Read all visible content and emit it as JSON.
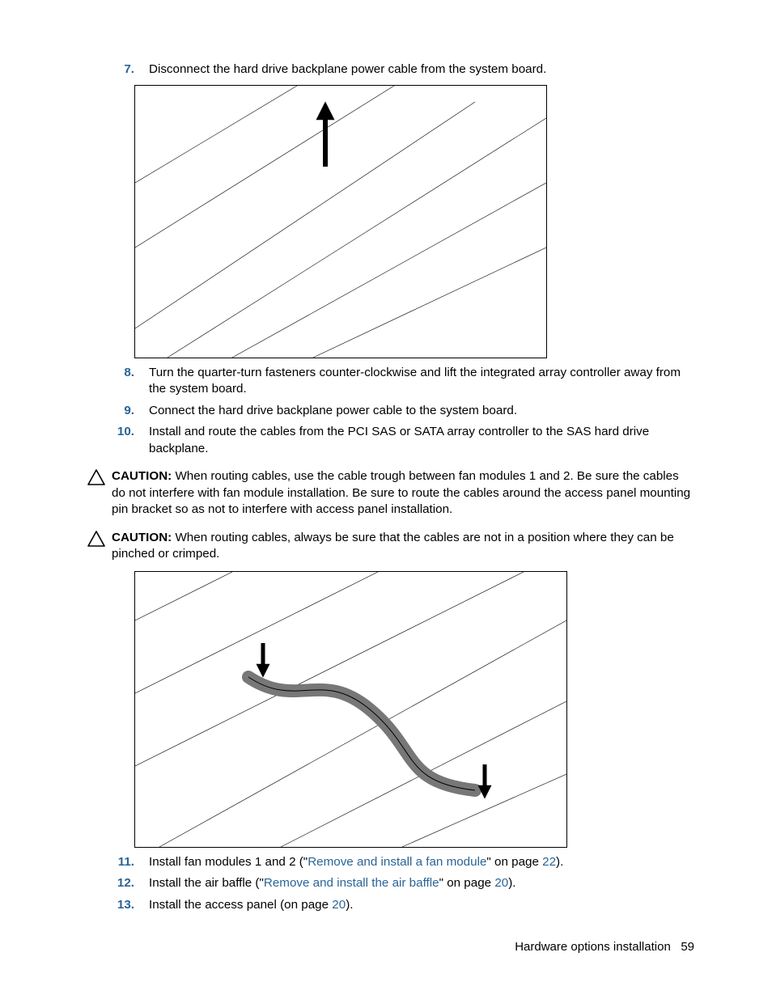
{
  "steps": {
    "s7": {
      "num": "7.",
      "text": "Disconnect the hard drive backplane power cable from the system board."
    },
    "s8": {
      "num": "8.",
      "text": "Turn the quarter-turn fasteners counter-clockwise and lift the integrated array controller away from the system board."
    },
    "s9": {
      "num": "9.",
      "text": "Connect the hard drive backplane power cable to the system board."
    },
    "s10": {
      "num": "10.",
      "text": "Install and route the cables from the PCI SAS or SATA array controller to the SAS hard drive backplane."
    },
    "s11": {
      "num": "11.",
      "pre": "Install fan modules 1 and 2 (\"",
      "link": "Remove and install a fan module",
      "mid": "\" on page ",
      "page": "22",
      "post": ")."
    },
    "s12": {
      "num": "12.",
      "pre": "Install the air baffle (\"",
      "link": "Remove and install the air baffle",
      "mid": "\" on page ",
      "page": "20",
      "post": ")."
    },
    "s13": {
      "num": "13.",
      "pre": "Install the access panel (on page ",
      "page": "20",
      "post": ")."
    }
  },
  "cautions": {
    "c1": {
      "label": "CAUTION:",
      "text": "  When routing cables, use the cable trough between fan modules 1 and 2. Be sure the cables do not interfere with fan module installation. Be sure to route the cables around the access panel mounting pin bracket so as not to interfere with access panel installation."
    },
    "c2": {
      "label": "CAUTION:",
      "text": "  When routing cables, always be sure that the cables are not in a position where they can be pinched or crimped."
    }
  },
  "footer": {
    "section": "Hardware options installation",
    "page": "59"
  }
}
